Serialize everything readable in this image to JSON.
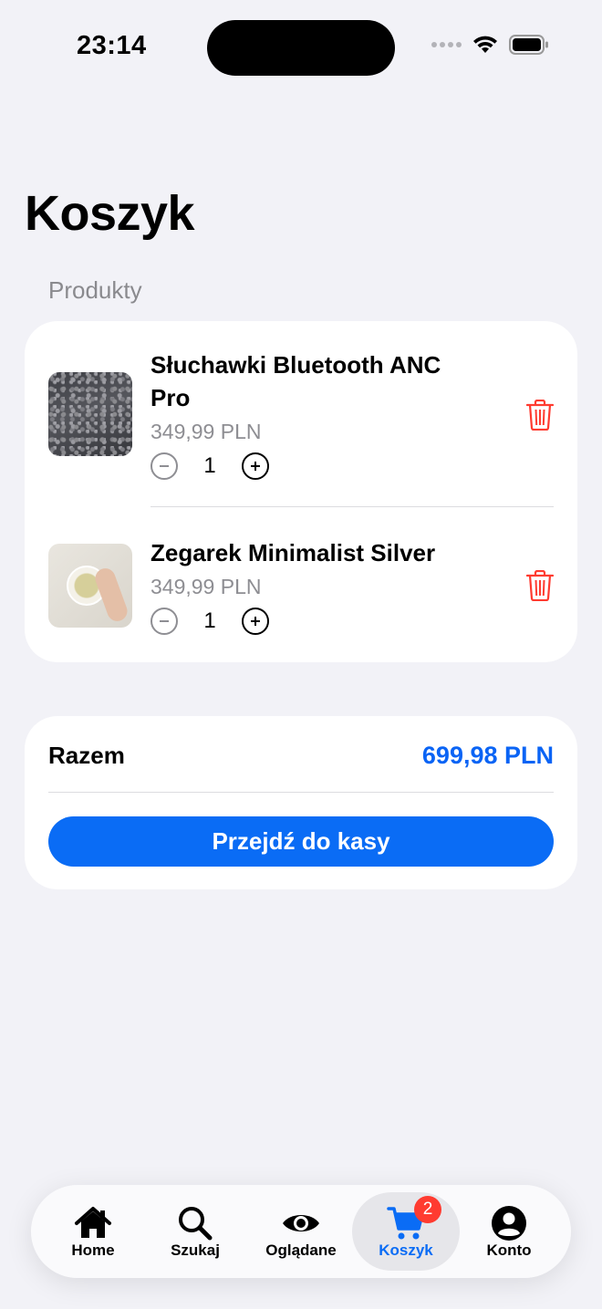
{
  "status_bar": {
    "time": "23:14"
  },
  "page": {
    "title": "Koszyk",
    "section_label": "Produkty"
  },
  "cart": {
    "items": [
      {
        "name": "Słuchawki Bluetooth ANC Pro",
        "price": "349,99 PLN",
        "quantity": "1"
      },
      {
        "name": "Zegarek Minimalist Silver",
        "price": "349,99 PLN",
        "quantity": "1"
      }
    ]
  },
  "summary": {
    "label": "Razem",
    "total": "699,98 PLN",
    "checkout_label": "Przejdź do kasy"
  },
  "tab_bar": {
    "tabs": [
      {
        "label": "Home",
        "icon": "house-icon"
      },
      {
        "label": "Szukaj",
        "icon": "magnifier-icon"
      },
      {
        "label": "Oglądane",
        "icon": "eye-icon"
      },
      {
        "label": "Koszyk",
        "icon": "cart-icon",
        "badge": "2",
        "active": true
      },
      {
        "label": "Konto",
        "icon": "person-circle-icon"
      }
    ]
  },
  "colors": {
    "accent": "#0a6cf5",
    "delete": "#ff3b30",
    "background": "#f2f2f7"
  }
}
